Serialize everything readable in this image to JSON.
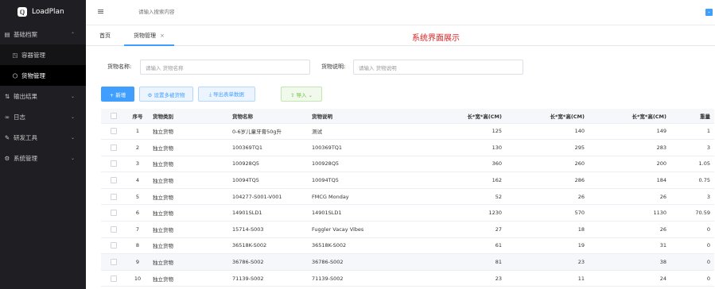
{
  "app": {
    "name": "LoadPlan"
  },
  "sidebar": {
    "items": [
      {
        "icon": "▤",
        "label": "基础档案",
        "chev": "⌃"
      },
      {
        "icon": "◳",
        "label": "容器管理"
      },
      {
        "icon": "⬡",
        "label": "货物管理"
      },
      {
        "icon": "⇅",
        "label": "输出结果",
        "chev": "⌄"
      },
      {
        "icon": "∞",
        "label": "日志",
        "chev": "⌄"
      },
      {
        "icon": "✎",
        "label": "研发工具",
        "chev": "⌄"
      },
      {
        "icon": "⚙",
        "label": "系统管理",
        "chev": "⌄"
      }
    ]
  },
  "topbar": {
    "menu_icon": "≡",
    "search_placeholder": "请输入搜索内容",
    "right_icon": "⌄"
  },
  "tabs": {
    "home": "首页",
    "current": "货物管理",
    "close": "×"
  },
  "watermark": "系统界面展示",
  "filters": {
    "name_label": "货物名称:",
    "name_placeholder": "请输入 货物名称",
    "desc_label": "货物说明:",
    "desc_placeholder": "请输入 货物说明"
  },
  "toolbar": {
    "add": "+ 新增",
    "set_multi": "⚙ 设置多被货物",
    "export": "⤓ 导出表单数据",
    "import": "⇧ 导入 ⌄"
  },
  "table": {
    "headers": [
      "序号",
      "货物类别",
      "货物名称",
      "货物说明",
      "长*宽*高(CM)",
      "长*宽*高(CM)",
      "长*宽*高(CM)",
      "重量"
    ],
    "rows": [
      [
        "1",
        "独立货物",
        "0-6岁儿童牙膏50g升",
        "测试",
        "125",
        "140",
        "149",
        "1"
      ],
      [
        "2",
        "独立货物",
        "100369TQ1",
        "100369TQ1",
        "130",
        "295",
        "283",
        "3"
      ],
      [
        "3",
        "独立货物",
        "100928Q5",
        "100928Q5",
        "360",
        "260",
        "200",
        "1.05"
      ],
      [
        "4",
        "独立货物",
        "10094TQ5",
        "10094TQ5",
        "162",
        "286",
        "184",
        "0.75"
      ],
      [
        "5",
        "独立货物",
        "104277-S001-V001",
        "FMCG Monday",
        "52",
        "26",
        "26",
        "3"
      ],
      [
        "6",
        "独立货物",
        "14901SLD1",
        "14901SLD1",
        "1230",
        "570",
        "1130",
        "70.59"
      ],
      [
        "7",
        "独立货物",
        "15714-S003",
        "Fuggler Vacay Vibes",
        "27",
        "18",
        "26",
        "0"
      ],
      [
        "8",
        "独立货物",
        "36518K-S002",
        "36518K-S002",
        "61",
        "19",
        "31",
        "0"
      ],
      [
        "9",
        "独立货物",
        "36786-S002",
        "36786-S002",
        "81",
        "23",
        "38",
        "0"
      ],
      [
        "10",
        "独立货物",
        "71139-S002",
        "71139-S002",
        "23",
        "11",
        "24",
        "0"
      ]
    ]
  },
  "colors": {
    "primary": "#409eff",
    "sidebar_bg": "#1f1f23",
    "watermark": "#e02020"
  }
}
